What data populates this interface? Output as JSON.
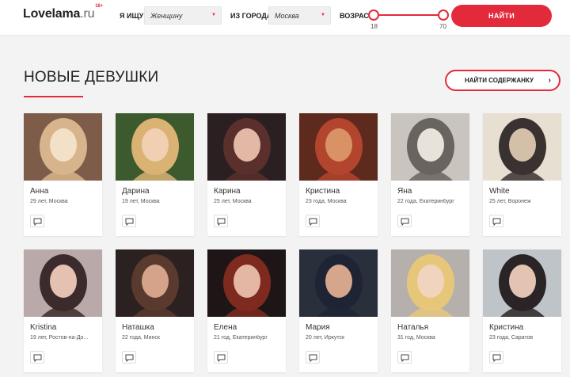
{
  "header": {
    "logo_name": "Lovelama",
    "logo_domain": ".ru",
    "logo_badge": "18+",
    "seek_label": "Я ИЩУ",
    "seek_value": "Женщину",
    "city_label": "ИЗ ГОРОДА",
    "city_value": "Москва",
    "age_label": "ВОЗРАСТ",
    "age_min": "18",
    "age_max": "70",
    "find_button": "НАЙТИ"
  },
  "section": {
    "title": "НОВЫЕ ДЕВУШКИ",
    "keeper_button": "НАЙТИ СОДЕРЖАНКУ",
    "keeper_arrow": "›"
  },
  "colors": {
    "accent": "#e32a3b"
  },
  "profiles": [
    {
      "name": "Анна",
      "meta": "29 лет, Москва",
      "palette": [
        "#7d5d4a",
        "#d8b48c",
        "#f2e1c7"
      ]
    },
    {
      "name": "Дарина",
      "meta": "19 лет, Москва",
      "palette": [
        "#3c5a2e",
        "#d9b274",
        "#f0cfb3"
      ]
    },
    {
      "name": "Карина",
      "meta": "25 лет, Москва",
      "palette": [
        "#2a2022",
        "#5a2f2c",
        "#e2b9a4"
      ]
    },
    {
      "name": "Кристина",
      "meta": "23 года, Москва",
      "palette": [
        "#5e2a1e",
        "#b3442e",
        "#d99265"
      ]
    },
    {
      "name": "Яна",
      "meta": "22 года, Екатеринбург",
      "palette": [
        "#c9c4bd",
        "#6a6460",
        "#e7e2da"
      ]
    },
    {
      "name": "White",
      "meta": "25 лет, Воронеж",
      "palette": [
        "#e8dfd3",
        "#3a3230",
        "#d4bfa9"
      ]
    },
    {
      "name": "Kristina",
      "meta": "19 лет, Ростов-на-До...",
      "palette": [
        "#b9a9a8",
        "#3b2b2c",
        "#e5c1b2"
      ]
    },
    {
      "name": "Наташка",
      "meta": "22 года, Минск",
      "palette": [
        "#2b2120",
        "#5a3a2e",
        "#d4a38a"
      ]
    },
    {
      "name": "Елена",
      "meta": "21 год, Екатеринбург",
      "palette": [
        "#1e1616",
        "#7e2a1e",
        "#e3b7a3"
      ]
    },
    {
      "name": "Мария",
      "meta": "20 лет, Иркутск",
      "palette": [
        "#2a2f3c",
        "#1f2435",
        "#d6a68c"
      ]
    },
    {
      "name": "Наталья",
      "meta": "31 год, Москва",
      "palette": [
        "#b5b0ab",
        "#e6c77a",
        "#f1d4bd"
      ]
    },
    {
      "name": "Кристина",
      "meta": "23 года, Саратов",
      "palette": [
        "#bfc4c8",
        "#2a2426",
        "#e3c3b2"
      ]
    }
  ]
}
